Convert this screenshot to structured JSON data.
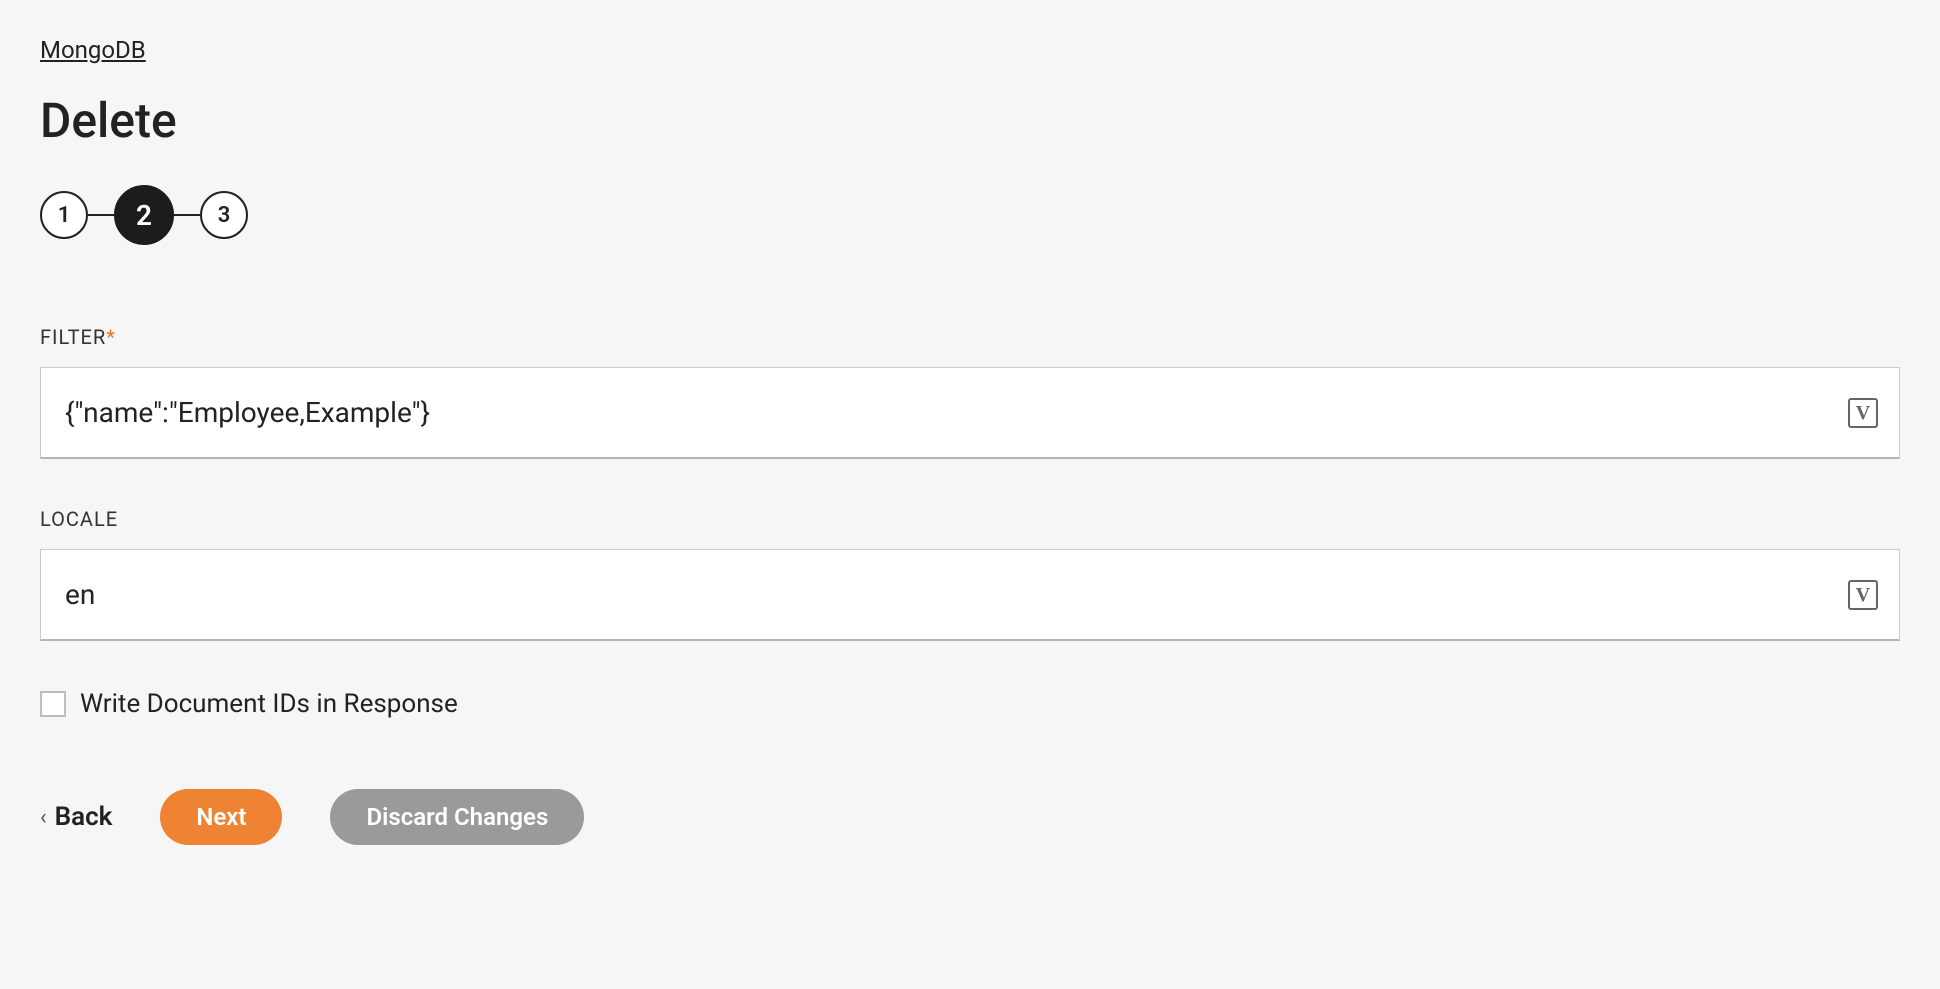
{
  "breadcrumb": {
    "label": "MongoDB"
  },
  "title": "Delete",
  "stepper": {
    "steps": [
      "1",
      "2",
      "3"
    ],
    "active_index": 1
  },
  "form": {
    "filter": {
      "label": "FILTER",
      "required_mark": "*",
      "value": "{\"name\":\"Employee,Example\"}"
    },
    "locale": {
      "label": "LOCALE",
      "value": "en"
    },
    "write_ids": {
      "label": "Write Document IDs in Response",
      "checked": false
    }
  },
  "variable_badge": "V",
  "buttons": {
    "back": "Back",
    "next": "Next",
    "discard": "Discard Changes"
  }
}
